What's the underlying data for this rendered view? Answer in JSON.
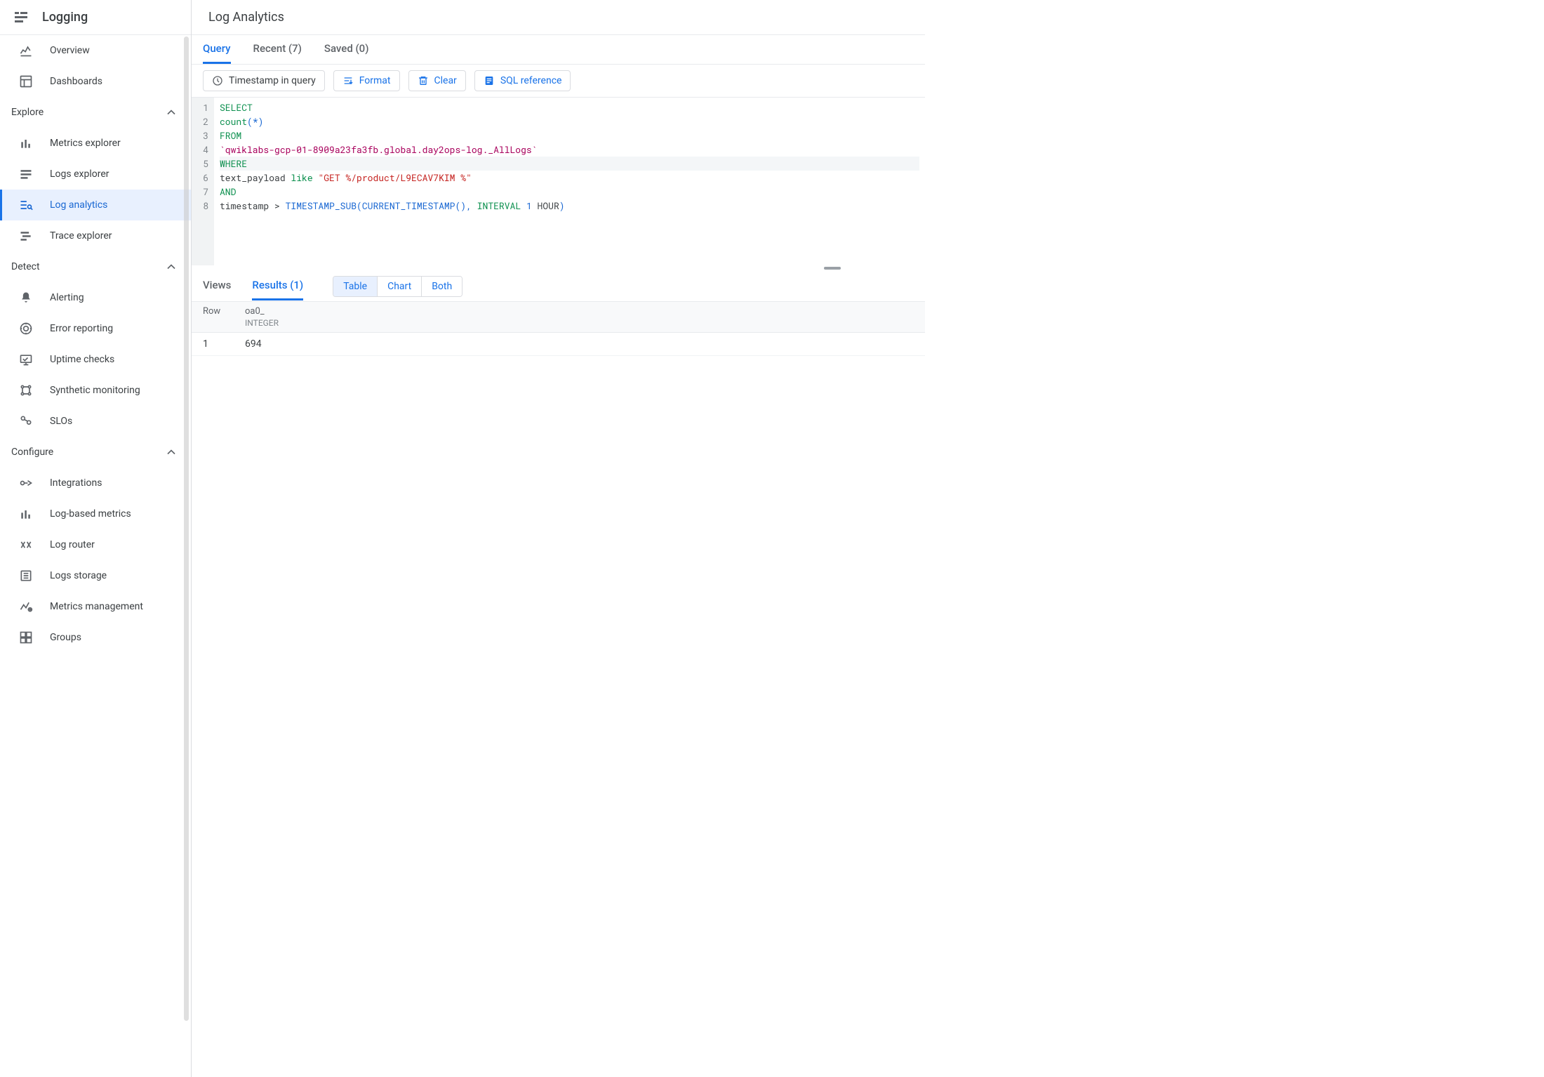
{
  "sidebar": {
    "title": "Logging",
    "topItems": [
      {
        "label": "Overview",
        "icon": "overview"
      },
      {
        "label": "Dashboards",
        "icon": "dashboards"
      }
    ],
    "sections": [
      {
        "label": "Explore",
        "items": [
          {
            "label": "Metrics explorer",
            "icon": "bars"
          },
          {
            "label": "Logs explorer",
            "icon": "logs"
          },
          {
            "label": "Log analytics",
            "icon": "log-analytics",
            "active": true
          },
          {
            "label": "Trace explorer",
            "icon": "trace"
          }
        ]
      },
      {
        "label": "Detect",
        "items": [
          {
            "label": "Alerting",
            "icon": "bell"
          },
          {
            "label": "Error reporting",
            "icon": "error"
          },
          {
            "label": "Uptime checks",
            "icon": "uptime"
          },
          {
            "label": "Synthetic monitoring",
            "icon": "synthetic"
          },
          {
            "label": "SLOs",
            "icon": "slo"
          }
        ]
      },
      {
        "label": "Configure",
        "items": [
          {
            "label": "Integrations",
            "icon": "integrations"
          },
          {
            "label": "Log-based metrics",
            "icon": "bars"
          },
          {
            "label": "Log router",
            "icon": "router"
          },
          {
            "label": "Logs storage",
            "icon": "storage"
          },
          {
            "label": "Metrics management",
            "icon": "metrics-mgmt"
          },
          {
            "label": "Groups",
            "icon": "groups"
          }
        ]
      }
    ]
  },
  "page": {
    "title": "Log Analytics"
  },
  "queryTabs": [
    {
      "label": "Query",
      "active": true
    },
    {
      "label": "Recent (7)"
    },
    {
      "label": "Saved (0)"
    }
  ],
  "toolbar": {
    "timestamp": "Timestamp in query",
    "format": "Format",
    "clear": "Clear",
    "sqlRef": "SQL reference"
  },
  "sql": {
    "lines": [
      [
        {
          "t": "SELECT",
          "c": "kw"
        }
      ],
      [
        {
          "t": "count",
          "c": "kw"
        },
        {
          "t": "(",
          "c": "p"
        },
        {
          "t": "*",
          "c": "p"
        },
        {
          "t": ")",
          "c": "p"
        }
      ],
      [
        {
          "t": "FROM",
          "c": "kw"
        }
      ],
      [
        {
          "t": "`qwiklabs-gcp-01-8909a23fa3fb.global.day2ops-log._AllLogs`",
          "c": "id"
        }
      ],
      [
        {
          "t": "WHERE",
          "c": "kw"
        }
      ],
      [
        {
          "t": "text_payload ",
          "c": "plain"
        },
        {
          "t": "like ",
          "c": "kw"
        },
        {
          "t": "\"GET %/product/L9ECAV7KIM %\"",
          "c": "str"
        }
      ],
      [
        {
          "t": "AND",
          "c": "kw"
        }
      ],
      [
        {
          "t": "timestamp ",
          "c": "plain"
        },
        {
          "t": "> ",
          "c": "plain"
        },
        {
          "t": "TIMESTAMP_SUB",
          "c": "fn"
        },
        {
          "t": "(",
          "c": "p"
        },
        {
          "t": "CURRENT_TIMESTAMP",
          "c": "fn"
        },
        {
          "t": "(",
          "c": "p"
        },
        {
          "t": ")",
          "c": "p"
        },
        {
          "t": ",",
          "c": "p"
        },
        {
          "t": " INTERVAL ",
          "c": "kw"
        },
        {
          "t": "1",
          "c": "num"
        },
        {
          "t": " HOUR",
          "c": "plain"
        },
        {
          "t": ")",
          "c": "p"
        }
      ]
    ],
    "highlightLine": 5
  },
  "resultsTabs": {
    "views": "Views",
    "results": "Results (1)"
  },
  "viewToggle": [
    "Table",
    "Chart",
    "Both"
  ],
  "viewActive": "Table",
  "resultsTable": {
    "header": {
      "row": "Row",
      "col": "oa0_",
      "type": "INTEGER"
    },
    "rows": [
      {
        "n": "1",
        "v": "694"
      }
    ]
  }
}
